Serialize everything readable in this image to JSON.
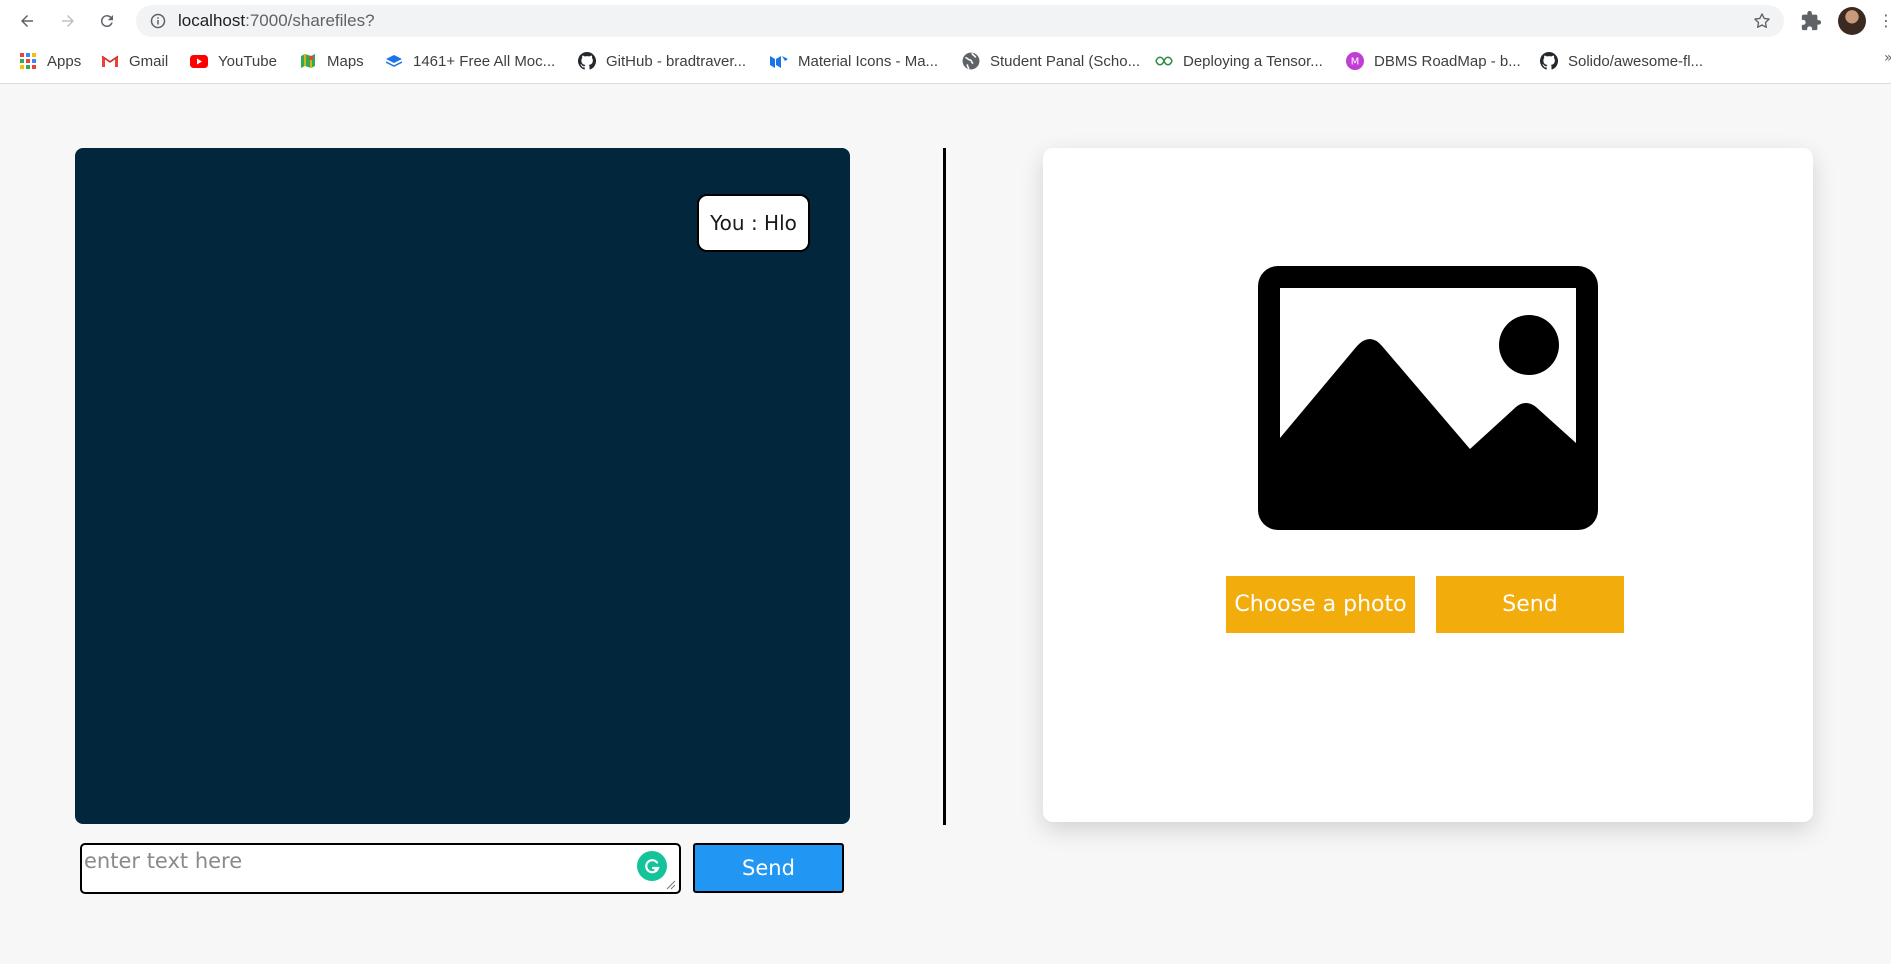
{
  "browser": {
    "url_host": "localhost",
    "url_path": ":7000/sharefiles?",
    "icons": {
      "back": "back-arrow-icon",
      "forward": "forward-arrow-icon",
      "reload": "reload-icon",
      "info": "info-icon",
      "bookmark_star": "star-icon",
      "extensions": "puzzle-icon",
      "profile": "avatar",
      "menu": "more-icon"
    },
    "bookmarks": [
      {
        "label": "Apps",
        "icon": "apps-grid-icon"
      },
      {
        "label": "Gmail",
        "icon": "gmail-icon"
      },
      {
        "label": "YouTube",
        "icon": "youtube-icon"
      },
      {
        "label": "Maps",
        "icon": "maps-icon"
      },
      {
        "label": "1461+ Free All Moc...",
        "icon": "layers-icon"
      },
      {
        "label": "GitHub - bradtraver...",
        "icon": "github-icon"
      },
      {
        "label": "Material Icons - Ma...",
        "icon": "material-icon"
      },
      {
        "label": "Student Panal (Scho...",
        "icon": "globe-icon"
      },
      {
        "label": "Deploying a Tensor...",
        "icon": "link-icon"
      },
      {
        "label": "DBMS RoadMap - b...",
        "icon": "m-circle-icon"
      },
      {
        "label": "Solido/awesome-fl...",
        "icon": "github-icon"
      }
    ],
    "bookmarks_overflow": "»"
  },
  "chat": {
    "message": "You : Hlo",
    "input_placeholder": "enter text here",
    "input_value": "",
    "send_label": "Send"
  },
  "upload": {
    "image_icon": "image-placeholder-icon",
    "choose_label": "Choose a photo",
    "send_label": "Send"
  },
  "colors": {
    "chat_panel_bg": "#02263c",
    "chat_send_bg": "#2196f3",
    "upload_btn_bg": "#f2ac0c",
    "page_bg": "#f7f7f7",
    "grammarly_green": "#15c39a"
  }
}
